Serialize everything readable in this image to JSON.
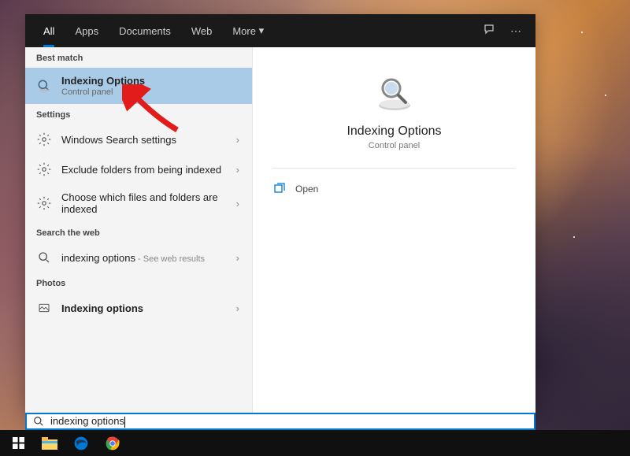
{
  "tabs": {
    "all": "All",
    "apps": "Apps",
    "documents": "Documents",
    "web": "Web",
    "more": "More"
  },
  "sections": {
    "bestMatch": "Best match",
    "settings": "Settings",
    "searchWeb": "Search the web",
    "photos": "Photos"
  },
  "bestMatch": {
    "title": "Indexing Options",
    "sub": "Control panel"
  },
  "settingsItems": [
    {
      "label": "Windows Search settings"
    },
    {
      "label": "Exclude folders from being indexed"
    },
    {
      "label": "Choose which files and folders are indexed"
    }
  ],
  "webItem": {
    "label": "indexing options",
    "hint": " - See web results"
  },
  "photosItem": {
    "label": "Indexing options"
  },
  "detail": {
    "title": "Indexing Options",
    "sub": "Control panel",
    "open": "Open"
  },
  "search": {
    "value": "indexing options"
  }
}
